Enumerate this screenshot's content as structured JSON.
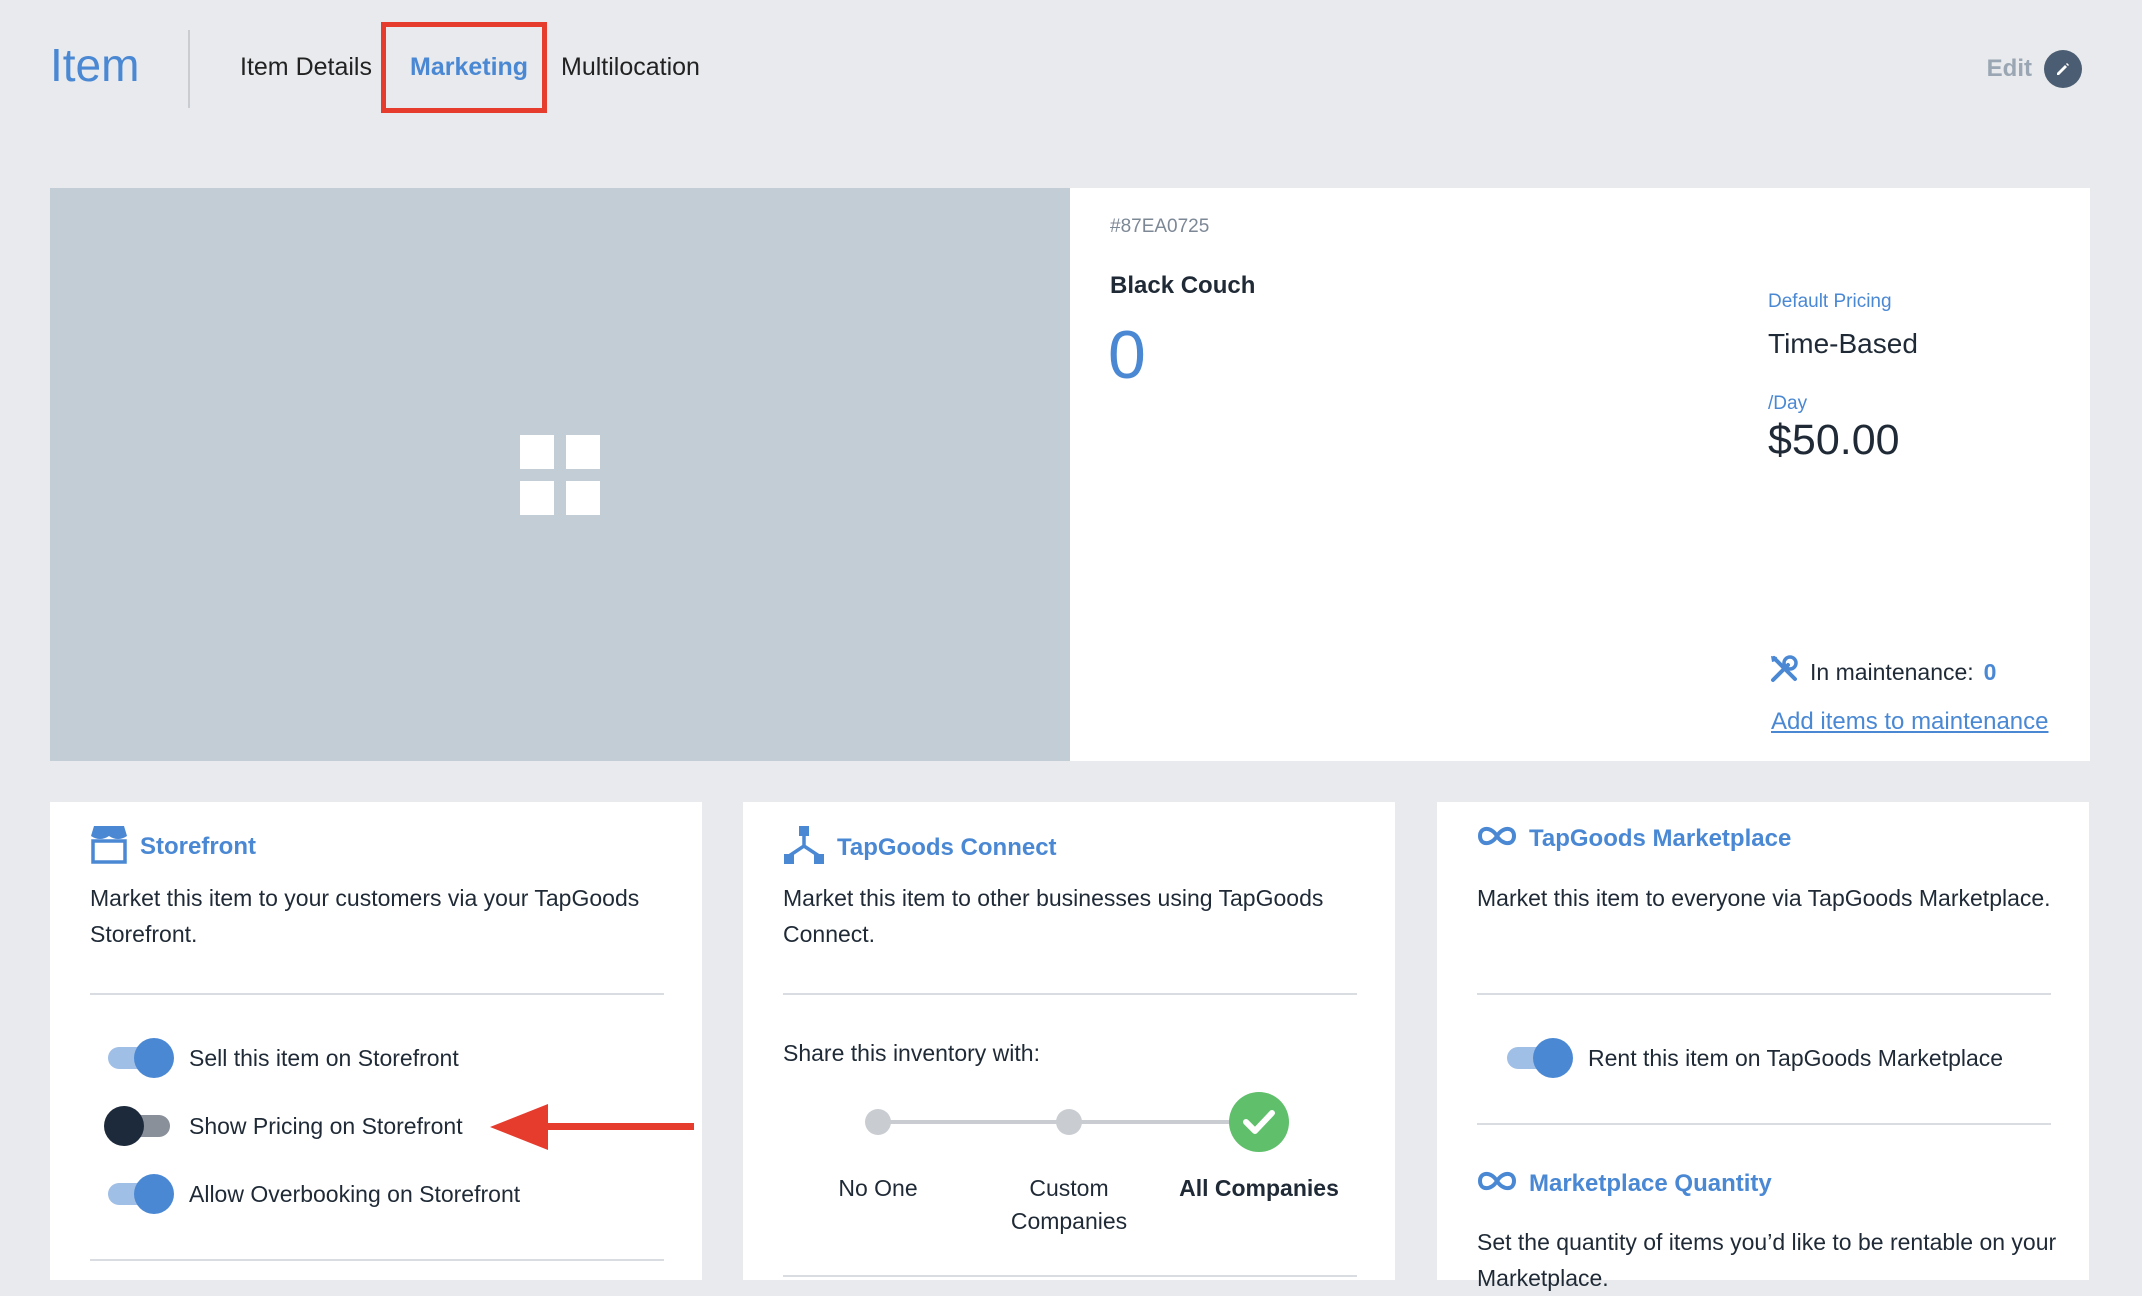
{
  "header": {
    "title": "Item",
    "tabs": [
      {
        "label": "Item Details"
      },
      {
        "label": "Marketing"
      },
      {
        "label": "Multilocation"
      }
    ],
    "edit_label": "Edit"
  },
  "item": {
    "sku": "#87EA0725",
    "name": "Black Couch",
    "quantity": "0",
    "pricing_label": "Default Pricing",
    "pricing_value": "Time-Based",
    "period": "/Day",
    "price": "$50.00",
    "maintenance_label": "In maintenance:",
    "maintenance_count": "0",
    "maintenance_link": "Add items to maintenance"
  },
  "storefront": {
    "title": "Storefront",
    "desc": "Market this item to your customers via your TapGoods Storefront.",
    "toggles": [
      {
        "label": "Sell this item on Storefront",
        "on": true
      },
      {
        "label": "Show Pricing on Storefront",
        "on": false
      },
      {
        "label": "Allow Overbooking on Storefront",
        "on": true
      }
    ]
  },
  "connect": {
    "title": "TapGoods Connect",
    "desc": "Market this item to other businesses using TapGoods Connect.",
    "share_label": "Share this inventory with:",
    "options": [
      {
        "label": "No One"
      },
      {
        "label": "Custom Companies"
      },
      {
        "label": "All Companies"
      }
    ],
    "selected": "All Companies"
  },
  "marketplace": {
    "title": "TapGoods Marketplace",
    "desc": "Market this item to everyone via TapGoods Marketplace.",
    "toggle_label": "Rent this item on TapGoods Marketplace",
    "toggle_on": true,
    "quantity_title": "Marketplace Quantity",
    "quantity_desc": "Set the quantity of items you’d like to be rentable on your Marketplace."
  },
  "colors": {
    "accent": "#4a88d4",
    "annotation": "#e53c2e",
    "success": "#5fbf6b"
  }
}
